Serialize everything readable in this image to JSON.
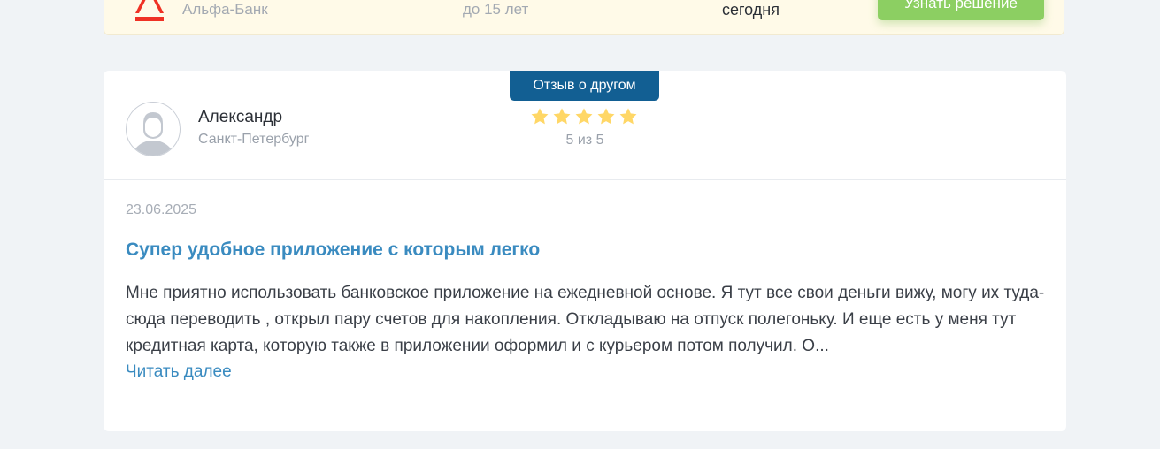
{
  "offer": {
    "bank_name": "Альфа-Банк",
    "term": "до 15 лет",
    "decision_time": "сегодня",
    "button_label": "Узнать решение",
    "accent_color": "#8ccf62",
    "logo_color": "#ef3124"
  },
  "review": {
    "type_badge": "Отзыв о другом",
    "author": {
      "name": "Александр",
      "city": "Санкт-Петербург",
      "avatar_icon": "user-avatar-icon"
    },
    "rating": {
      "value": 5,
      "max": 5,
      "text": "5 из 5",
      "star_color": "#ffd766"
    },
    "date": "23.06.2025",
    "title": "Супер удобное приложение с которым легко",
    "text": "Мне приятно использовать банковское приложение на ежедневной основе. Я тут все свои деньги вижу, могу их туда-сюда переводить , открыл пару счетов для накопления. Откладываю на отпуск полегоньку. И еще есть у меня тут кредитная карта, которую также в приложении оформил и с курьером потом получил. О...",
    "read_more": "Читать далее",
    "badge_color": "#125f93",
    "title_color": "#3a8bc0"
  }
}
